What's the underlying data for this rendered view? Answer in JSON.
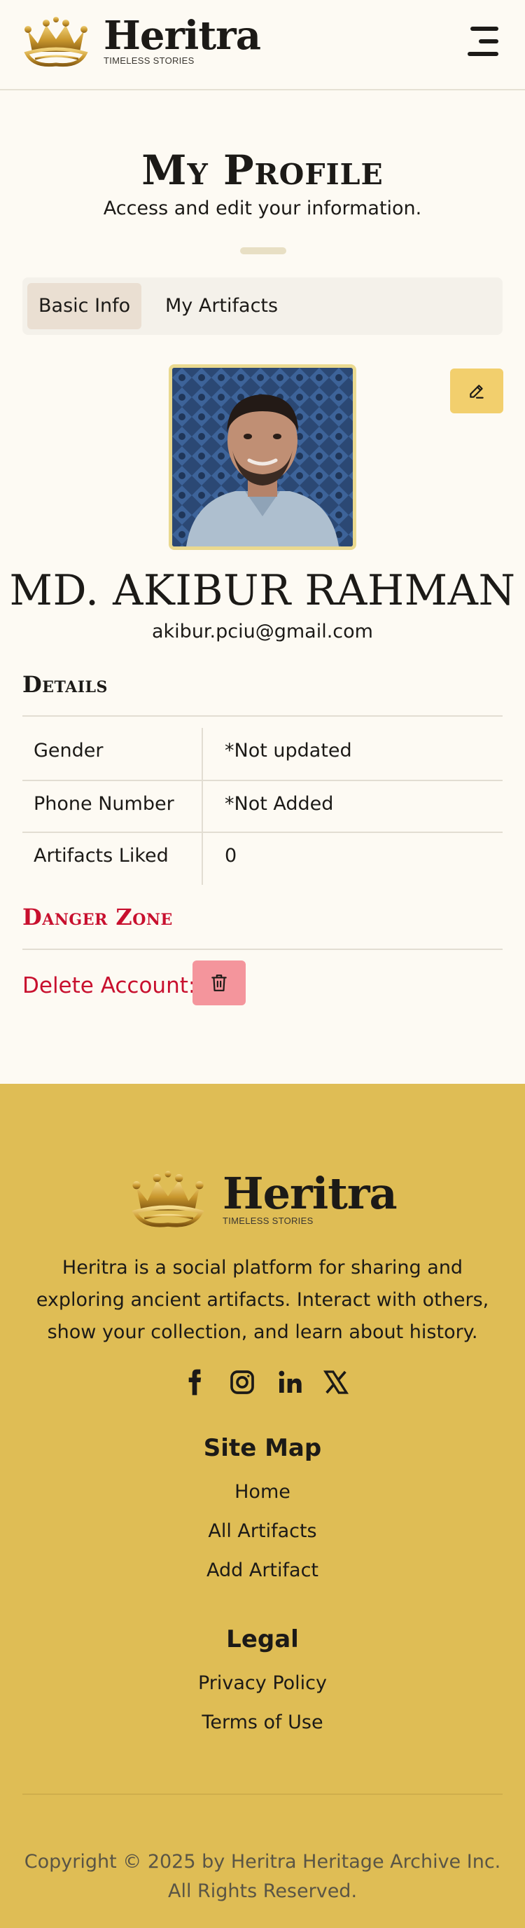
{
  "brand": {
    "name": "Heritra",
    "tagline": "TIMELESS STORIES",
    "gold": "#c9972d",
    "footer_bg": "#dfbd55"
  },
  "header": {
    "menu_icon": "hamburger-menu-icon"
  },
  "page": {
    "title": "My Profile",
    "subtitle": "Access and edit your information."
  },
  "tabs": [
    {
      "label": "Basic Info",
      "active": true
    },
    {
      "label": "My Artifacts",
      "active": false
    }
  ],
  "profile": {
    "name": "MD. AKIBUR RAHMAN",
    "email": "akibur.pciu@gmail.com",
    "edit_icon": "pencil-icon"
  },
  "details": {
    "heading": "Details",
    "rows": [
      {
        "label": "Gender",
        "value": "*Not updated"
      },
      {
        "label": "Phone Number",
        "value": "*Not Added"
      },
      {
        "label": "Artifacts Liked",
        "value": "0"
      }
    ]
  },
  "danger": {
    "heading": "Danger Zone",
    "delete_label": "Delete Account:",
    "delete_icon": "trash-icon",
    "color": "#c8102e"
  },
  "footer": {
    "description": "Heritra is a social platform for sharing and exploring ancient artifacts. Interact with others, show your collection, and learn about history.",
    "socials": [
      "facebook-icon",
      "instagram-icon",
      "linkedin-icon",
      "x-icon"
    ],
    "sitemap": {
      "heading": "Site Map",
      "links": [
        "Home",
        "All Artifacts",
        "Add Artifact"
      ]
    },
    "legal": {
      "heading": "Legal",
      "links": [
        "Privacy Policy",
        "Terms of Use"
      ]
    },
    "copyright": "Copyright © 2025 by Heritra Heritage Archive Inc. All Rights Reserved."
  }
}
